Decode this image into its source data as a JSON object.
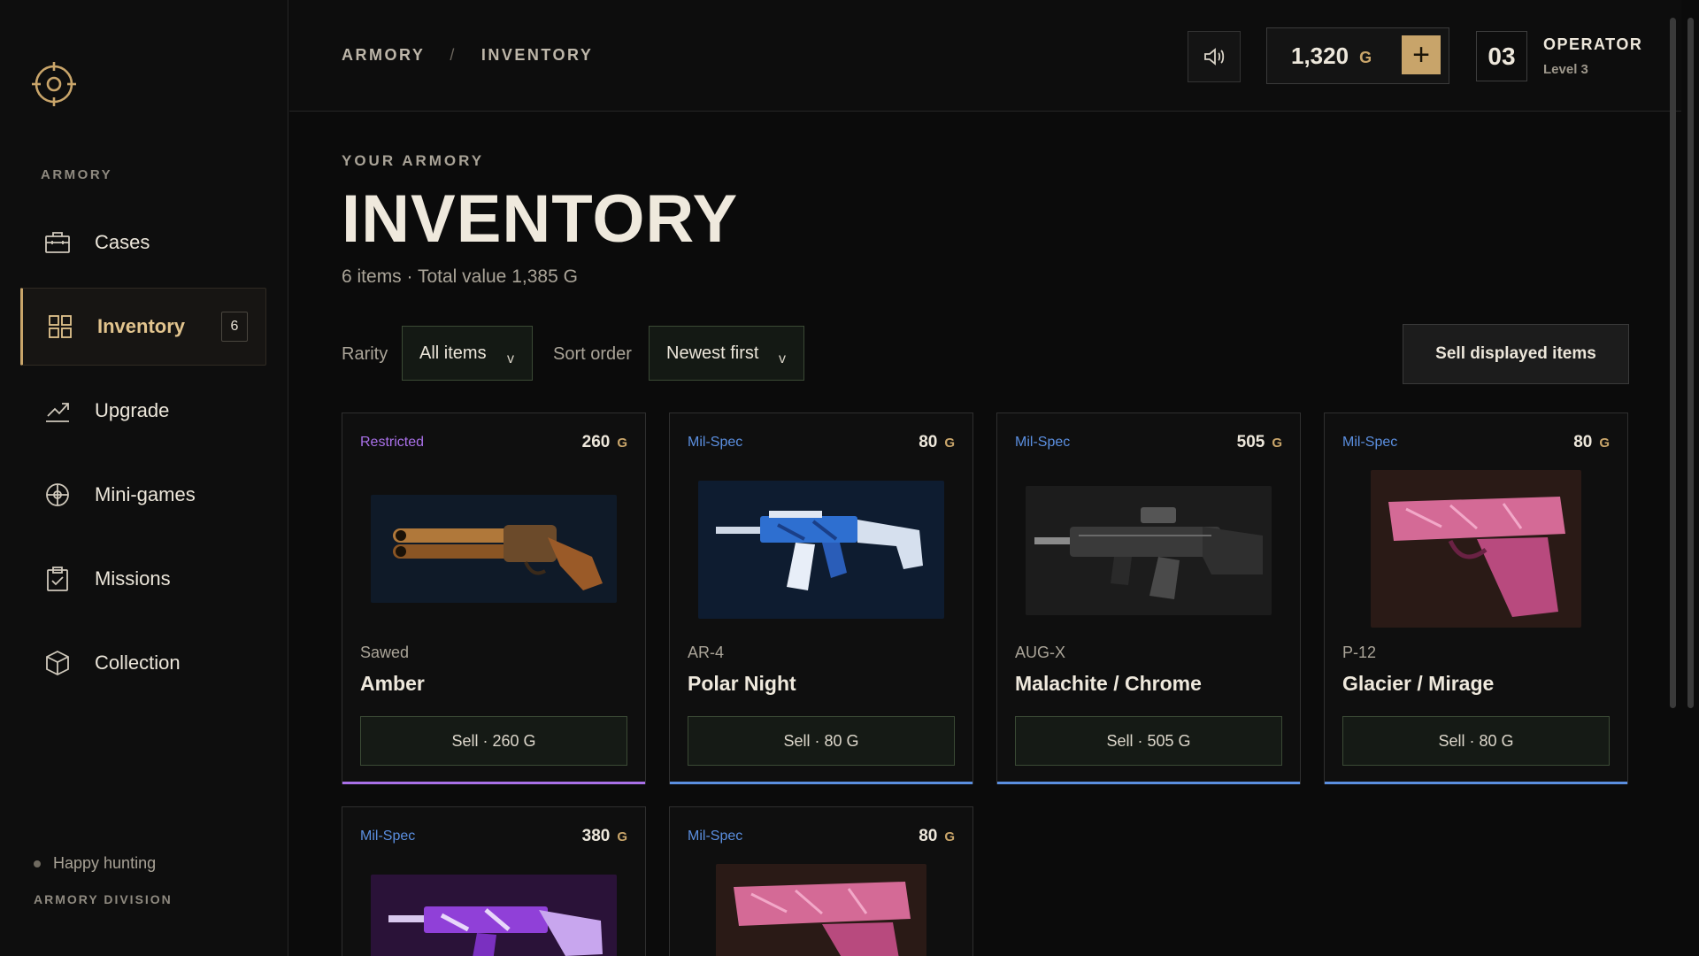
{
  "sidebar": {
    "section_label": "ARMORY",
    "items": [
      {
        "label": "Cases",
        "icon": "briefcase-icon"
      },
      {
        "label": "Inventory",
        "icon": "grid-icon",
        "badge": "6",
        "active": true
      },
      {
        "label": "Upgrade",
        "icon": "trend-up-icon"
      },
      {
        "label": "Mini-games",
        "icon": "target-icon"
      },
      {
        "label": "Missions",
        "icon": "clipboard-icon"
      },
      {
        "label": "Collection",
        "icon": "cube-icon"
      }
    ],
    "status_text": "Happy hunting",
    "division": "ARMORY DIVISION"
  },
  "header": {
    "breadcrumb": [
      "ARMORY",
      "INVENTORY"
    ],
    "breadcrumb_sep": "/",
    "balance": "1,320",
    "currency": "G",
    "level_number": "03",
    "operator_title": "OPERATOR",
    "operator_level": "Level 3"
  },
  "page": {
    "eyebrow": "YOUR ARMORY",
    "title": "INVENTORY",
    "subtitle": "6 items · Total value 1,385 G"
  },
  "filters": {
    "rarity_label": "Rarity",
    "rarity_value": "All items",
    "sort_label": "Sort order",
    "sort_value": "Newest first",
    "chevron": "v",
    "sell_all_label": "Sell displayed items"
  },
  "colors": {
    "accent_gold": "#c9a56a",
    "restricted": "#a970e8",
    "milspec": "#5b8fe0"
  },
  "items": [
    {
      "rarity": "Restricted",
      "price": "260",
      "currency": "G",
      "model": "Sawed",
      "name": "Amber",
      "sell_label": "Sell · 260 G"
    },
    {
      "rarity": "Mil-Spec",
      "price": "80",
      "currency": "G",
      "model": "AR-4",
      "name": "Polar Night",
      "sell_label": "Sell · 80 G"
    },
    {
      "rarity": "Mil-Spec",
      "price": "505",
      "currency": "G",
      "model": "AUG-X",
      "name": "Malachite / Chrome",
      "sell_label": "Sell · 505 G"
    },
    {
      "rarity": "Mil-Spec",
      "price": "80",
      "currency": "G",
      "model": "P-12",
      "name": "Glacier / Mirage",
      "sell_label": "Sell · 80 G"
    },
    {
      "rarity": "Mil-Spec",
      "price": "380",
      "currency": "G"
    },
    {
      "rarity": "Mil-Spec",
      "price": "80",
      "currency": "G"
    }
  ]
}
